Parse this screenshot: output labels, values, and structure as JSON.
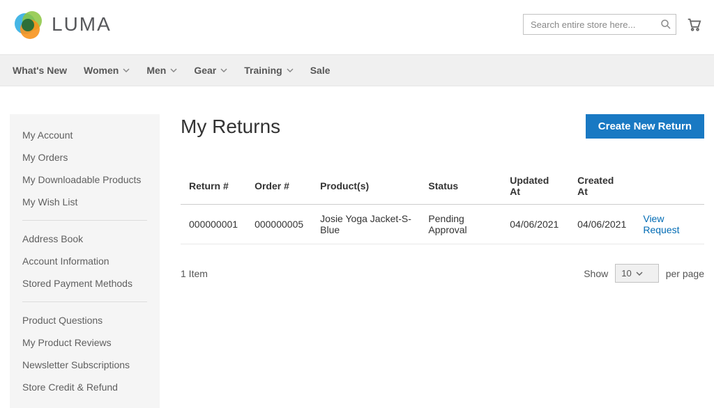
{
  "header": {
    "brand": "LUMA",
    "search_placeholder": "Search entire store here..."
  },
  "nav": [
    {
      "label": "What's New",
      "has_menu": false
    },
    {
      "label": "Women",
      "has_menu": true
    },
    {
      "label": "Men",
      "has_menu": true
    },
    {
      "label": "Gear",
      "has_menu": true
    },
    {
      "label": "Training",
      "has_menu": true
    },
    {
      "label": "Sale",
      "has_menu": false
    }
  ],
  "sidebar": {
    "groups": [
      [
        "My Account",
        "My Orders",
        "My Downloadable Products",
        "My Wish List"
      ],
      [
        "Address Book",
        "Account Information",
        "Stored Payment Methods"
      ],
      [
        "Product Questions",
        "My Product Reviews",
        "Newsletter Subscriptions",
        "Store Credit & Refund"
      ]
    ]
  },
  "main": {
    "title": "My Returns",
    "create_btn": "Create New Return",
    "columns": [
      "Return #",
      "Order #",
      "Product(s)",
      "Status",
      "Updated At",
      "Created At",
      ""
    ],
    "rows": [
      {
        "return_no": "000000001",
        "order_no": "000000005",
        "products": "Josie Yoga Jacket-S-Blue",
        "status": "Pending Approval",
        "updated_at": "04/06/2021",
        "created_at": "04/06/2021",
        "action_label": "View Request"
      }
    ],
    "toolbar": {
      "count_text": "1 Item",
      "show_label": "Show",
      "limiter_value": "10",
      "per_page_label": "per page"
    }
  }
}
